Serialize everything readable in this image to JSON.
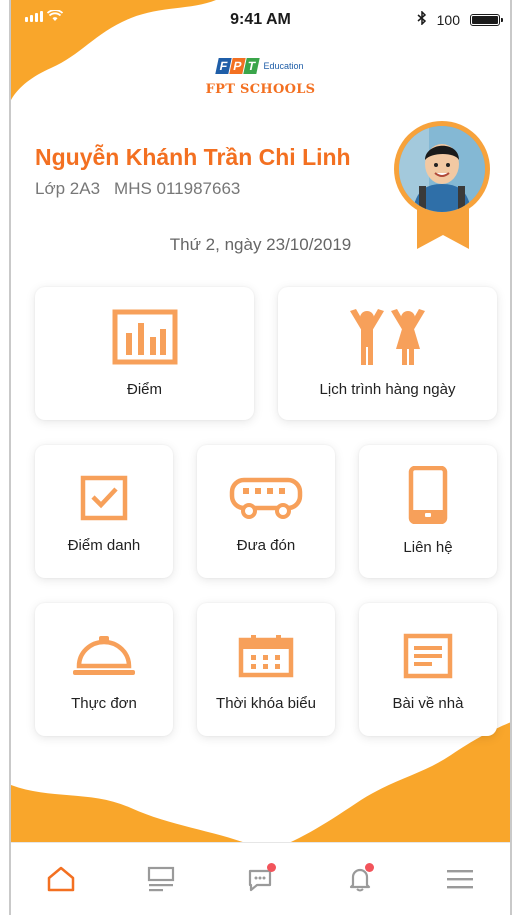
{
  "status_bar": {
    "time": "9:41 AM",
    "battery": "100"
  },
  "brand": {
    "letters": [
      "F",
      "P",
      "T"
    ],
    "letter_colors": [
      "#1f5ea8",
      "#f37021",
      "#3aa54a"
    ],
    "sub": "Education",
    "schools": "FPT SCHOOLS"
  },
  "student": {
    "name": "Nguyễn Khánh Trần Chi Linh",
    "class": "Lớp 2A3",
    "id": "MHS 011987663"
  },
  "date": "Thứ 2, ngày 23/10/2019",
  "menu": {
    "grades": "Điểm",
    "schedule": "Lịch trình hàng ngày",
    "attendance": "Điểm danh",
    "pickup": "Đưa đón",
    "contact": "Liên hệ",
    "meal": "Thực đơn",
    "timetable": "Thời khóa biểu",
    "homework": "Bài về nhà"
  },
  "colors": {
    "accent": "#f37021",
    "icon": "#f7a05a",
    "blob": "#f9a62b",
    "nav_dot": "#f2545b"
  },
  "icons": {
    "grades": "bar-chart-icon",
    "schedule": "children-icon",
    "attendance": "checkbox-icon",
    "pickup": "bus-icon",
    "contact": "phone-icon",
    "meal": "cloche-icon",
    "timetable": "calendar-icon",
    "homework": "document-icon"
  },
  "nav": [
    "home-icon",
    "news-icon",
    "chat-icon",
    "bell-icon",
    "menu-icon"
  ]
}
